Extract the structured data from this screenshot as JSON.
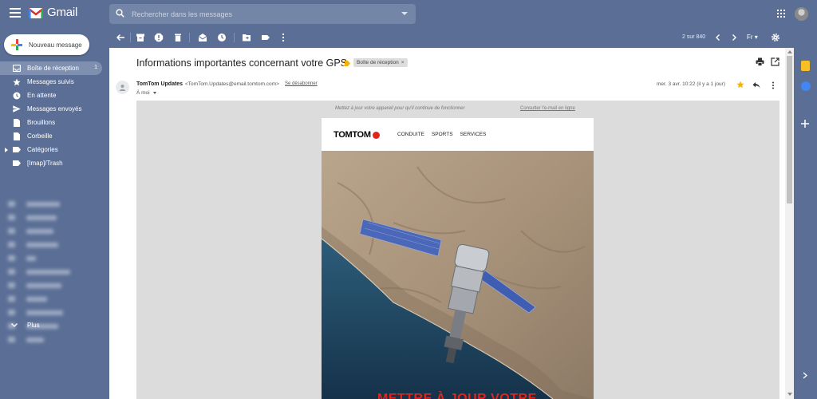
{
  "app": {
    "name": "Gmail",
    "search_placeholder": "Rechercher dans les messages"
  },
  "sidebar": {
    "compose_label": "Nouveau message",
    "items": [
      {
        "label": "Boîte de réception",
        "count": "1",
        "icon": "inbox-icon",
        "active": true
      },
      {
        "label": "Messages suivis",
        "count": "",
        "icon": "star-icon"
      },
      {
        "label": "En attente",
        "count": "",
        "icon": "clock-icon"
      },
      {
        "label": "Messages envoyés",
        "count": "",
        "icon": "send-icon"
      },
      {
        "label": "Brouillons",
        "count": "",
        "icon": "draft-icon"
      },
      {
        "label": "Corbeille",
        "count": "",
        "icon": "trash-icon"
      },
      {
        "label": "Catégories",
        "count": "",
        "icon": "label-icon"
      },
      {
        "label": "[Imap]/Trash",
        "count": "",
        "icon": "label-icon"
      }
    ],
    "more_label": "Plus"
  },
  "toolbar": {
    "pager": "2 sur 840",
    "language": "Fr"
  },
  "email": {
    "subject": "Informations importantes concernant votre GPS",
    "label_tag": "Boîte de réception",
    "sender_name": "TomTom Updates",
    "sender_email": "<TomTom.Updates@email.tomtom.com>",
    "unsubscribe": "Se désabonner",
    "recipient": "À moi",
    "date": "mer. 3 avr. 10:22 (il y a 1 jour)",
    "preheader": "Mettez à jour votre appareil pour qu'il continue de fonctionner",
    "online_link": "Consulter l'e-mail en ligne",
    "brand": "TOMTOM",
    "nav": [
      "CONDUITE",
      "SPORTS",
      "SERVICES"
    ],
    "hero_title": "METTRE À JOUR VOTRE"
  },
  "colors": {
    "chrome": "#5b6f96",
    "brand_red": "#e1251b"
  }
}
